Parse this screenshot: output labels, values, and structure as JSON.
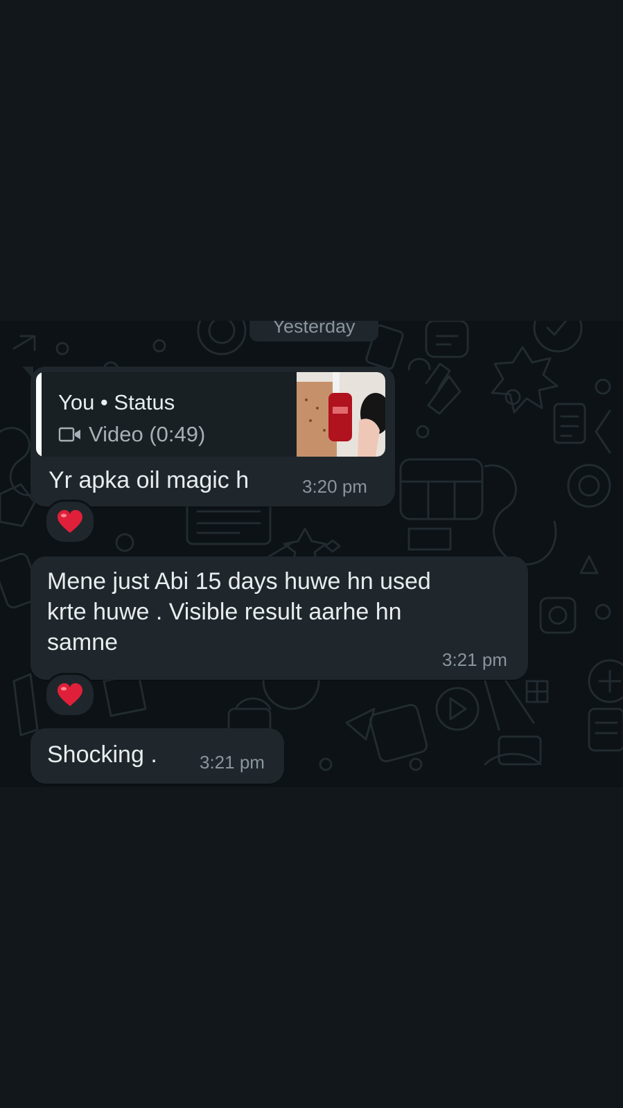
{
  "chat": {
    "date_chip": "Yesterday",
    "messages": [
      {
        "quote": {
          "title": "You • Status",
          "subtitle": "Video (0:49)",
          "icon": "video-icon"
        },
        "text": "Yr apka oil magic h",
        "time": "3:20 pm",
        "reaction": "heart-emoji"
      },
      {
        "text": "Mene just Abi 15 days huwe hn used\nkrte huwe . Visible result aarhe hn\nsamne",
        "time": "3:21 pm",
        "reaction": "heart-emoji"
      },
      {
        "text": "Shocking .",
        "time": "3:21 pm"
      }
    ]
  },
  "colors": {
    "page_bg": "#12171b",
    "chat_bg": "#0c1216",
    "bubble_bg": "#1f272c",
    "text": "#e9edef",
    "meta_text": "#8a959c",
    "heart": "#e0203a"
  }
}
